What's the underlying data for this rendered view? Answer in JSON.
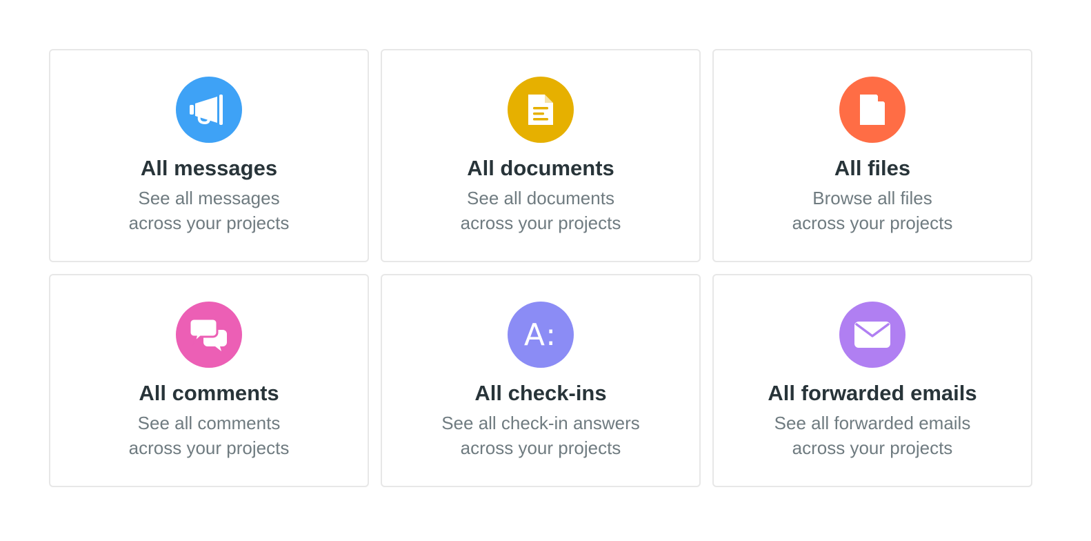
{
  "cards": [
    {
      "title": "All messages",
      "desc_line1": "See all messages",
      "desc_line2": "across your projects",
      "icon": "megaphone-icon",
      "color": "#3ea2f6"
    },
    {
      "title": "All documents",
      "desc_line1": "See all documents",
      "desc_line2": "across your projects",
      "icon": "document-icon",
      "color": "#e6b000"
    },
    {
      "title": "All files",
      "desc_line1": "Browse all files",
      "desc_line2": "across your projects",
      "icon": "file-icon",
      "color": "#ff6d45"
    },
    {
      "title": "All comments",
      "desc_line1": "See all comments",
      "desc_line2": "across your projects",
      "icon": "speech-bubbles-icon",
      "color": "#ec5fb5"
    },
    {
      "title": "All check-ins",
      "desc_line1": "See all check-in answers",
      "desc_line2": "across your projects",
      "icon": "checkin-answer-icon",
      "icon_text": "A:",
      "color": "#8b8cf5"
    },
    {
      "title": "All forwarded emails",
      "desc_line1": "See all forwarded emails",
      "desc_line2": "across your projects",
      "icon": "envelope-icon",
      "color": "#b07ff2"
    }
  ]
}
